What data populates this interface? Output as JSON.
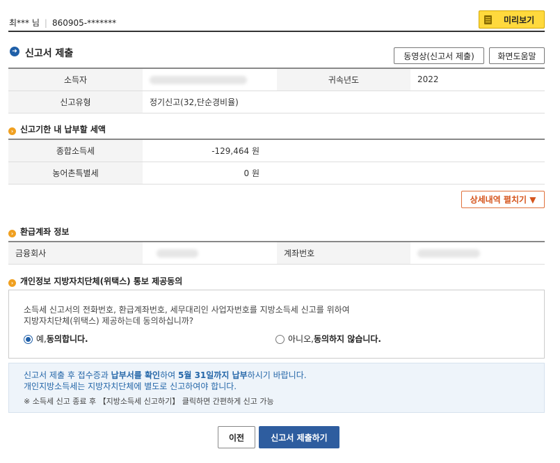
{
  "header": {
    "user_name": "최*** 님",
    "user_id": "860905-*******",
    "preview_label": "미리보기"
  },
  "page": {
    "title": "신고서 제출",
    "video_button": "동영상(신고서 제출)",
    "help_button": "화면도움말"
  },
  "basic_info": {
    "income_earner_label": "소득자",
    "year_label": "귀속년도",
    "year_value": "2022",
    "report_type_label": "신고유형",
    "report_type_value": "정기신고(32,단순경비율)"
  },
  "tax_section": {
    "title": "신고기한 내 납부할 세액",
    "rows": [
      {
        "label": "종합소득세",
        "value": "-129,464 원"
      },
      {
        "label": "농어촌특별세",
        "value": "0 원"
      }
    ],
    "detail_button": "상세내역 펼치기 ▼"
  },
  "refund_section": {
    "title": "환급계좌 정보",
    "bank_label": "금융회사",
    "account_label": "계좌번호"
  },
  "consent_section": {
    "title": "개인정보 지방자치단체(위택스) 통보 제공동의",
    "question_line1": "소득세 신고서의 전화번호, 환급계좌번호, 세무대리인 사업자번호를 지방소득세 신고를 위하여",
    "question_line2": "지방자치단체(위택스) 제공하는데 동의하십니까?",
    "agree_prefix": "예, ",
    "agree_bold": "동의합니다.",
    "disagree_prefix": "아니오, ",
    "disagree_bold": "동의하지 않습니다."
  },
  "notice": {
    "line1_a": "신고서 제출 후 접수증과 ",
    "line1_b": "납부서를 확인",
    "line1_c": "하여 ",
    "line1_d": "5월 31일까지 납부",
    "line1_e": "하시기 바랍니다.",
    "line2": "개인지방소득세는 지방자치단체에 별도로 신고하여야 합니다.",
    "line3": "※ 소득세 신고 종료 후 【지방소득세 신고하기】 클릭하면 간편하게 신고 가능"
  },
  "footer": {
    "prev_button": "이전",
    "submit_button": "신고서 제출하기"
  },
  "colors": {
    "accent_blue": "#2e5d9f",
    "preview_yellow": "#ffd93d",
    "detail_orange": "#d5541b",
    "notice_text": "#2466a8"
  }
}
